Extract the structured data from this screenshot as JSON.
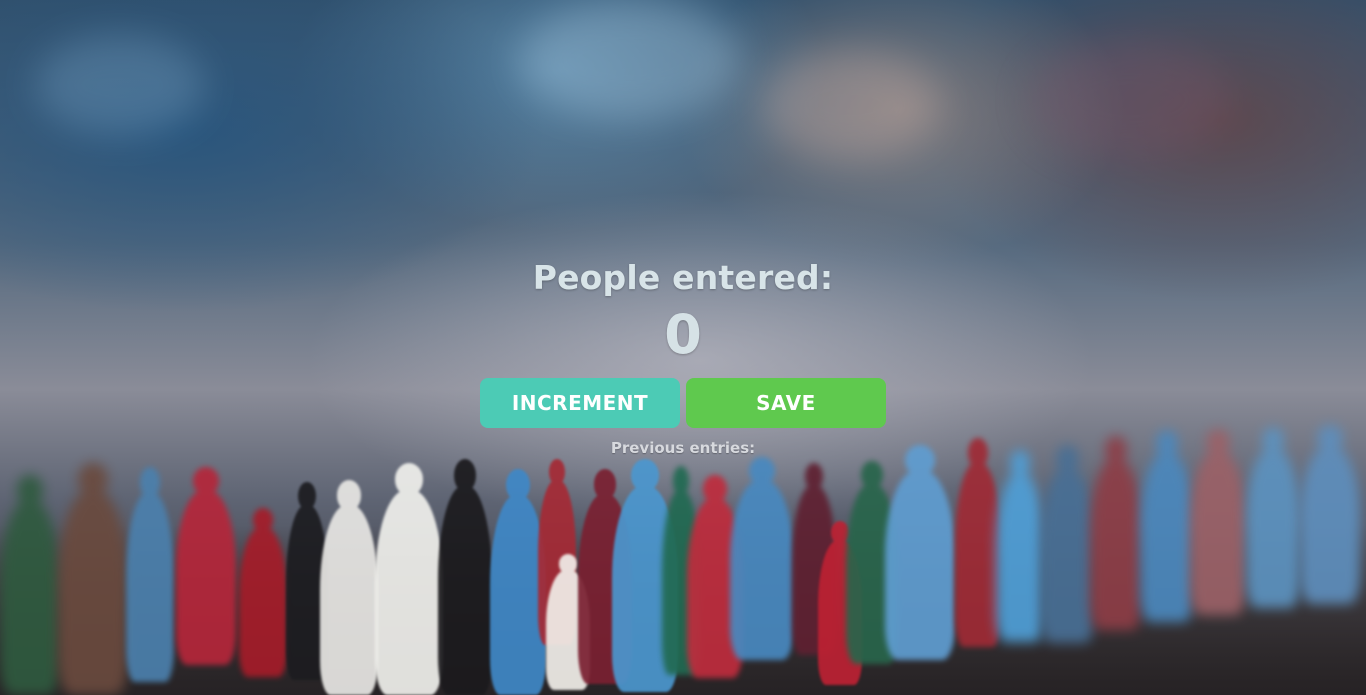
{
  "counter": {
    "title": "People entered:",
    "value": "0"
  },
  "actions": {
    "increment_label": "INCREMENT",
    "save_label": "SAVE"
  },
  "history": {
    "label": "Previous entries:"
  },
  "colors": {
    "increment_button": "#4ccbb5",
    "save_button": "#5fc94e",
    "text": "#d8e4e8"
  }
}
